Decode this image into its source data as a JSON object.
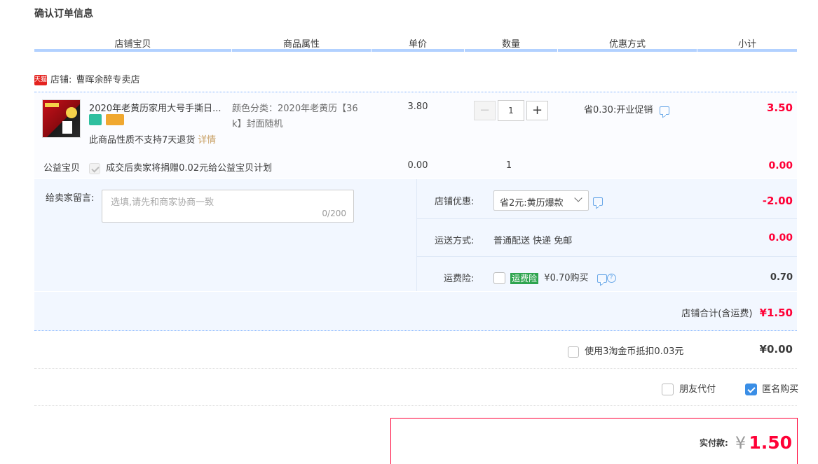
{
  "title": "确认订单信息",
  "columns": [
    "店铺宝贝",
    "商品属性",
    "单价",
    "数量",
    "优惠方式",
    "小计"
  ],
  "shop": {
    "badge": "天猫",
    "label": "店铺:",
    "name": "曹晖余醉专卖店"
  },
  "item": {
    "title": "2020年老黄历家用大号手撕日...",
    "attr": "颜色分类：2020年老黄历【36k】封面随机",
    "attr_line1": "颜色分类：2020年老黄历【36",
    "attr_line2": "k】封面随机",
    "price": "3.80",
    "quantity": "1",
    "discount": "省0.30:开业促销",
    "subtotal": "3.50",
    "no_return": "此商品性质不支持7天退货",
    "details_link": "详情"
  },
  "charity": {
    "label": "公益宝贝",
    "text": "成交后卖家将捐赠0.02元给公益宝贝计划",
    "price": "0.00",
    "quantity": "1",
    "subtotal": "0.00"
  },
  "message": {
    "label": "给卖家留言:",
    "placeholder": "选填,请先和商家协商一致",
    "counter": "0/200"
  },
  "shop_discount": {
    "label": "店铺优惠:",
    "selected": "省2元:黄历爆款",
    "amount": "-2.00"
  },
  "shipping": {
    "label": "运送方式:",
    "value": "普通配送 快递 免邮",
    "amount": "0.00"
  },
  "insurance": {
    "label": "运费险:",
    "tag": "运费险",
    "text": "¥0.70购买",
    "amount": "0.70"
  },
  "shop_total": {
    "label": "店铺合计(含运费)",
    "amount": "¥1.50"
  },
  "coins": {
    "label": "使用3淘金币抵扣0.03元",
    "amount": "¥0.00"
  },
  "options": {
    "friend_pay": "朋友代付",
    "anonymous": "匿名购买"
  },
  "final": {
    "label": "实付款:",
    "currency": "¥",
    "amount": "1.50"
  },
  "colors": {
    "accent_red": "#ff0036",
    "header_line": "#b2d1ff",
    "panel_bg": "#f2f7ff",
    "checkbox_blue": "#3a8ee6"
  }
}
